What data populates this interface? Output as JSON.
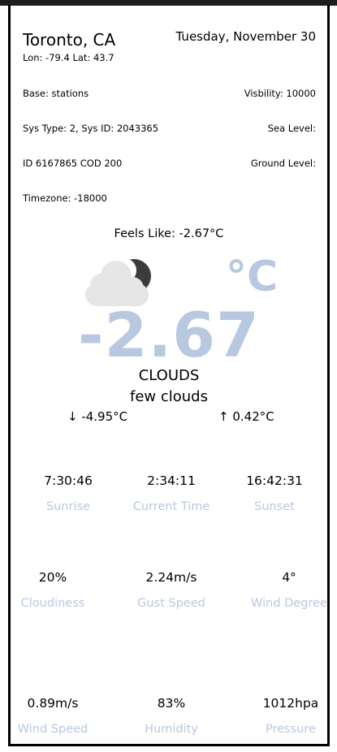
{
  "header": {
    "city": "Toronto, CA",
    "coords": "Lon: -79.4 Lat: 43.7",
    "date": "Tuesday, November 30"
  },
  "info": {
    "base": "Base: stations",
    "visibility": "Visbility: 10000",
    "sys": "Sys Type: 2, Sys ID: 2043365",
    "sea_level": "Sea Level:",
    "id_cod": "ID 6167865 COD 200",
    "ground_level": "Ground Level:",
    "timezone": "Timezone: -18000"
  },
  "current": {
    "feels_like": "Feels Like: -2.67°C",
    "icon": "partly-cloudy-night-icon",
    "unit": "°C",
    "temperature": "-2.67",
    "main": "CLOUDS",
    "description": "few clouds",
    "temp_min": "↓ -4.95°C",
    "temp_max": "↑ 0.42°C"
  },
  "rows": [
    {
      "items": [
        {
          "value": "7:30:46",
          "label": "Sunrise"
        },
        {
          "value": "2:34:11",
          "label": "Current Time"
        },
        {
          "value": "16:42:31",
          "label": "Sunset"
        }
      ]
    },
    {
      "items": [
        {
          "value": "20%",
          "label": "Cloudiness"
        },
        {
          "value": "2.24m/s",
          "label": "Gust Speed"
        },
        {
          "value": "4°",
          "label": "Wind Degree"
        }
      ]
    },
    {
      "items": [
        {
          "value": "0.89m/s",
          "label": "Wind Speed"
        },
        {
          "value": "83%",
          "label": "Humidity"
        },
        {
          "value": "1012hpa",
          "label": "Pressure"
        }
      ]
    }
  ],
  "colors": {
    "accent": "#b8c8e0",
    "border": "#000000",
    "cloud": "#e6e6e6",
    "moon": "#3c3c3c"
  }
}
